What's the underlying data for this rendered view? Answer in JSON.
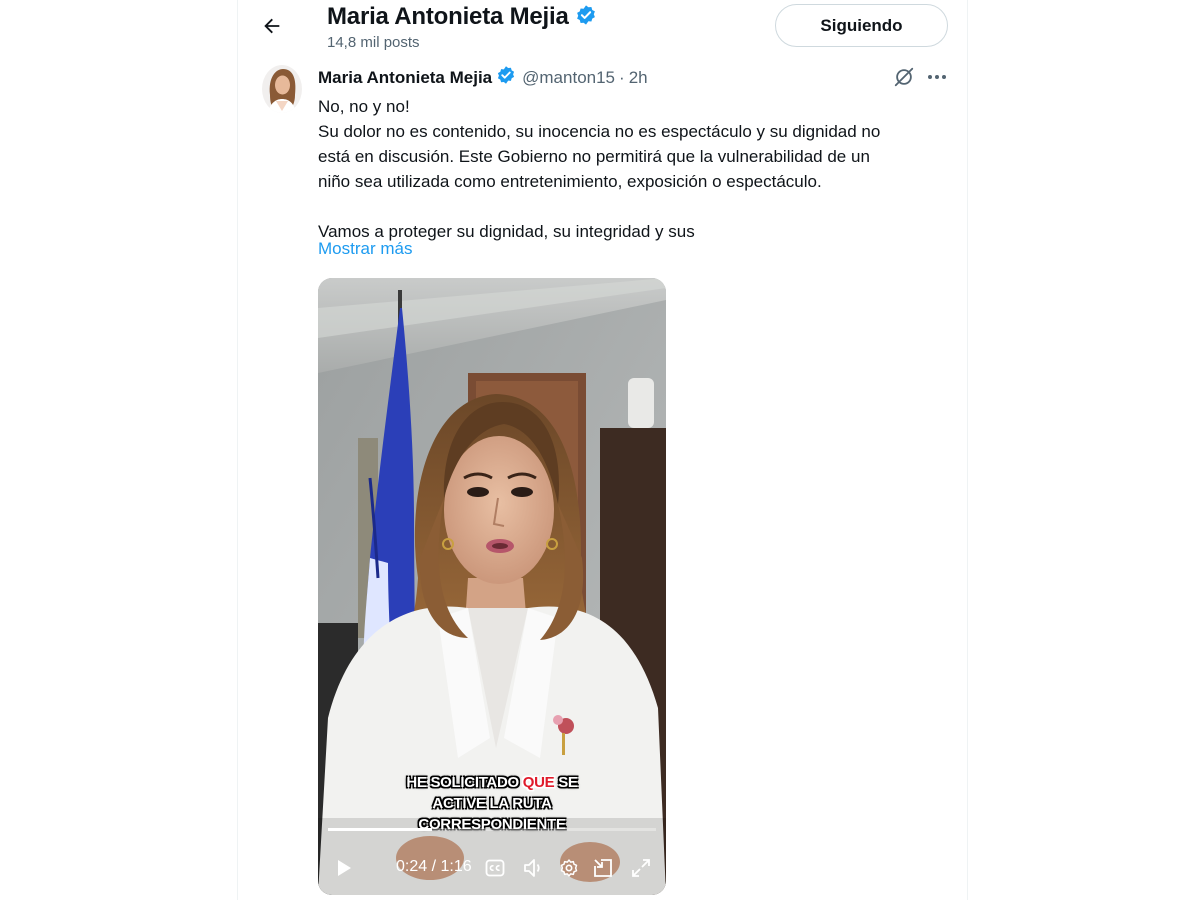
{
  "header": {
    "name": "Maria Antonieta Mejia",
    "posts": "14,8 mil posts",
    "follow_label": "Siguiendo"
  },
  "tweet": {
    "author": "Maria Antonieta Mejia",
    "handle": "@manton15",
    "separator": "·",
    "time": "2h",
    "lines": [
      "No, no y no!",
      "Su dolor no es contenido, su inocencia no es espectáculo y su dignidad no",
      "está en discusión. Este Gobierno no permitirá que la vulnerabilidad de un",
      "niño sea utilizada como entretenimiento, exposición o espectáculo.",
      "Vamos a proteger su dignidad, su integridad y sus"
    ],
    "show_more": "Mostrar más"
  },
  "video": {
    "caption_line1_before": "HE SOLICITADO ",
    "caption_highlight": "QUE",
    "caption_line1_after": " SE",
    "caption_line2": "ACTIVE LA RUTA",
    "caption_line3": "CORRESPONDIENTE",
    "time": "0:24 / 1:16",
    "progress": 0.316
  },
  "icons": {
    "back": "arrow-left-icon",
    "verified": "verified-badge-icon",
    "grok": "grok-icon",
    "more": "more-icon",
    "play": "play-icon",
    "cc": "captions-icon",
    "volume": "volume-icon",
    "settings": "gear-icon",
    "pip": "picture-in-picture-icon",
    "fullscreen": "fullscreen-icon"
  },
  "colors": {
    "accent": "#1d9bf0",
    "text": "#0f1419",
    "secondary": "#536471",
    "caption_highlight": "#e01b2b"
  }
}
